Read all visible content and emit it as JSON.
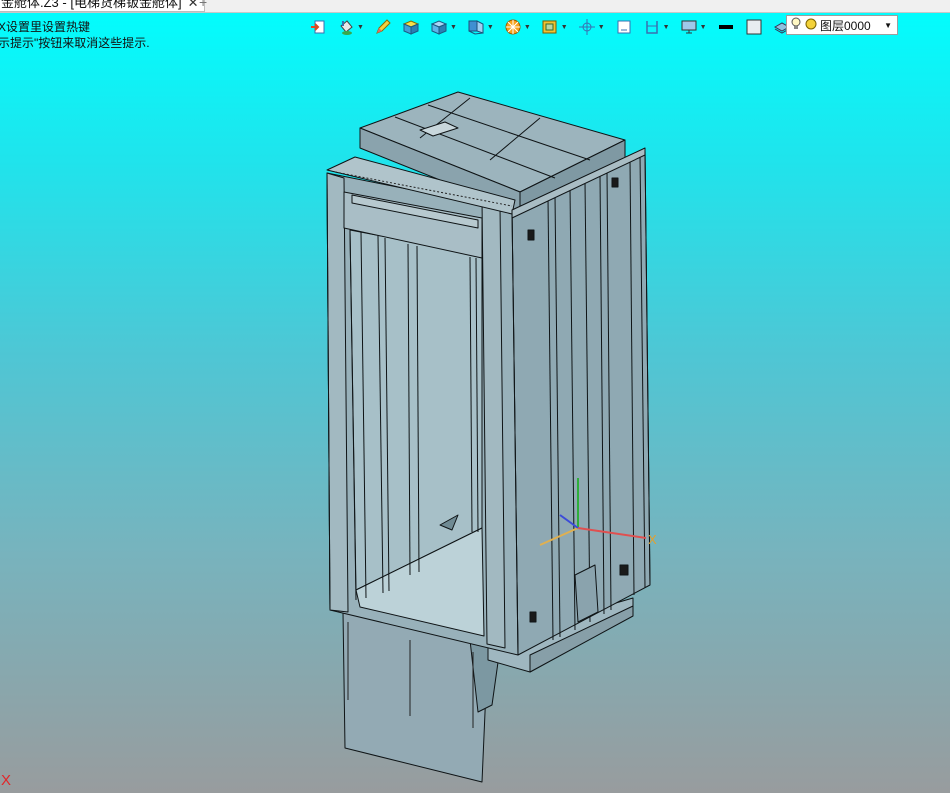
{
  "tab": {
    "title": "金舱体.Z3 - [电梯货梯钣金舱体]",
    "close_glyph": "✕",
    "new_tab_glyph": "+"
  },
  "hints": {
    "line1": "X设置里设置热键",
    "line2": "示提示\"按钮来取消这些提示."
  },
  "toolbar": {
    "items": [
      {
        "icon": "import-icon",
        "dropdown": false
      },
      {
        "icon": "paint-bucket-icon",
        "dropdown": true
      },
      {
        "icon": "pen-icon",
        "dropdown": false
      },
      {
        "icon": "yellow-box-icon",
        "dropdown": false
      },
      {
        "icon": "blue-box-icon",
        "dropdown": true
      },
      {
        "icon": "view-cube-icon",
        "dropdown": true
      },
      {
        "icon": "orientation-wheel-icon",
        "dropdown": true
      },
      {
        "icon": "shaded-view-icon",
        "dropdown": true
      },
      {
        "icon": "axis-pivot-icon",
        "dropdown": true
      },
      {
        "icon": "sheet-icon",
        "dropdown": false
      },
      {
        "icon": "frame-icon",
        "dropdown": true
      },
      {
        "icon": "monitor-icon",
        "dropdown": true
      },
      {
        "icon": "line-weight-icon",
        "dropdown": false
      },
      {
        "icon": "color-swatch-icon",
        "dropdown": false
      },
      {
        "icon": "layers-icon",
        "dropdown": true
      }
    ]
  },
  "layer_selector": {
    "value": "图层0000",
    "icons": [
      "lightbulb-icon",
      "layer-color-dot-icon"
    ]
  },
  "viewport": {
    "axis_label_x": "X",
    "corner_label": "X",
    "colors": {
      "background_top": "#00ffff",
      "background_bottom": "#989c9e",
      "model_fill": "#8aa8b4",
      "model_edge": "#0f1416"
    }
  }
}
